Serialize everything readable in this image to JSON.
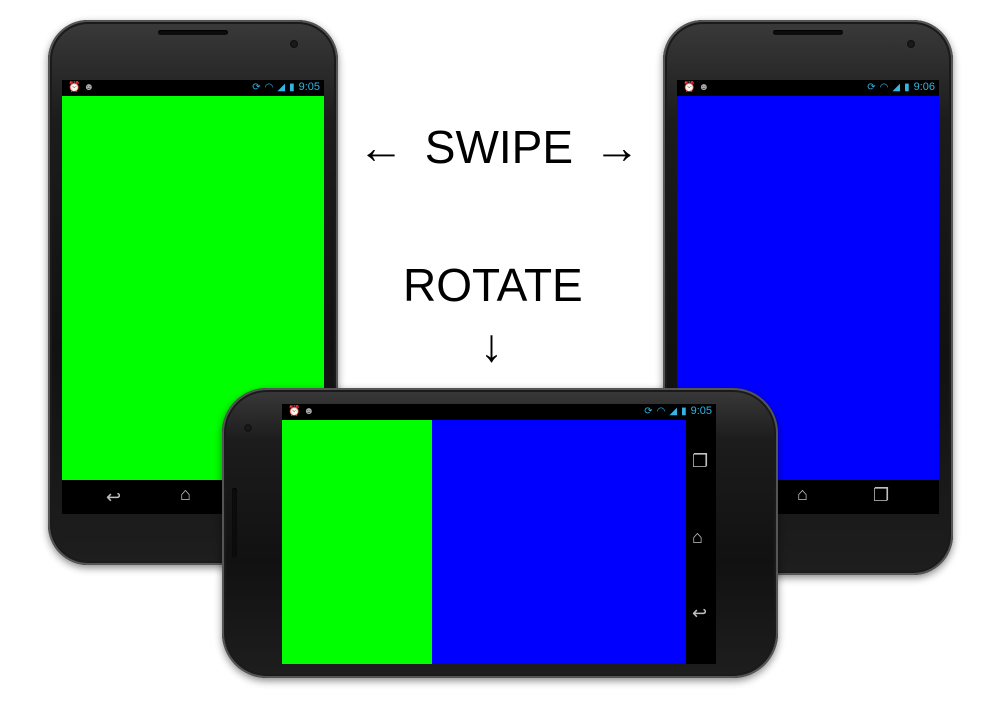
{
  "swipe_label": "SWIPE",
  "swipe_left_arrow": "←",
  "swipe_right_arrow": "→",
  "rotate_label": "ROTATE",
  "rotate_arrow": "↓",
  "phones": {
    "left": {
      "time": "9:05",
      "screen_color": "#00ff00"
    },
    "right": {
      "time": "9:06",
      "screen_color": "#0000ff"
    },
    "landscape": {
      "time": "9:05",
      "green_portion_color": "#00ff00",
      "blue_portion_color": "#0000ff"
    }
  },
  "icons": {
    "status_left": [
      "alarm-icon",
      "android-icon"
    ],
    "status_right": [
      "sync-icon",
      "wifi-icon",
      "signal-icon",
      "battery-icon"
    ],
    "nav": [
      "back-icon",
      "home-icon",
      "recents-icon"
    ]
  }
}
